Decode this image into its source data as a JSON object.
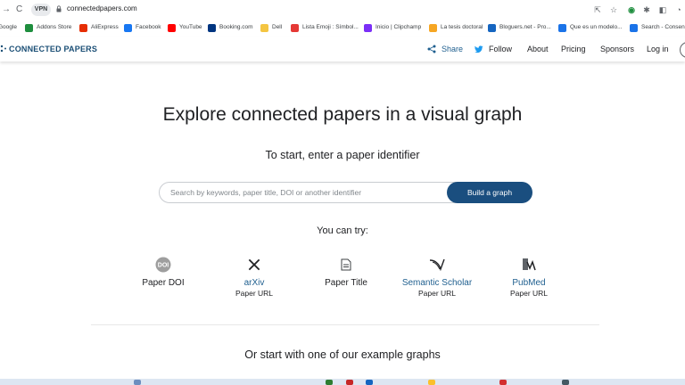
{
  "browser": {
    "url": "connectedpapers.com",
    "vpn_badge": "VPN",
    "bookmarks": [
      {
        "label": "Google",
        "color": "#ffffff"
      },
      {
        "label": "Addons Store",
        "color": "#1e8e3e"
      },
      {
        "label": "AliExpress",
        "color": "#e62e04"
      },
      {
        "label": "Facebook",
        "color": "#1877f2"
      },
      {
        "label": "YouTube",
        "color": "#ff0000"
      },
      {
        "label": "Booking.com",
        "color": "#003580"
      },
      {
        "label": "Dell",
        "color": "#f4c542"
      },
      {
        "label": "Lista Emoji : Símbol...",
        "color": "#e53935"
      },
      {
        "label": "Inicio | Clipchamp",
        "color": "#7b2ff7"
      },
      {
        "label": "La tesis doctoral",
        "color": "#f6a623"
      },
      {
        "label": "Bloguers.net - Pro...",
        "color": "#1565c0"
      },
      {
        "label": "Que es un modelo...",
        "color": "#1a73e8"
      },
      {
        "label": "Search - Consens",
        "color": "#1a73e8"
      }
    ]
  },
  "header": {
    "logo": "CONNECTED PAPERS",
    "nav": {
      "share": "Share",
      "follow": "Follow",
      "about": "About",
      "pricing": "Pricing",
      "sponsors": "Sponsors",
      "login": "Log in"
    }
  },
  "hero": {
    "title": "Explore connected papers in a visual graph",
    "subtitle": "To start, enter a paper identifier",
    "search_placeholder": "Search by keywords, paper title, DOI or another identifier",
    "build_button": "Build a graph",
    "try_label": "You can try:"
  },
  "options": [
    {
      "icon": "doi-icon",
      "name": "Paper DOI",
      "sub": ""
    },
    {
      "icon": "arxiv-icon",
      "name": "arXiv",
      "sub": "Paper URL"
    },
    {
      "icon": "document-icon",
      "name": "Paper Title",
      "sub": ""
    },
    {
      "icon": "semantic-scholar-icon",
      "name": "Semantic Scholar",
      "sub": "Paper URL"
    },
    {
      "icon": "pubmed-icon",
      "name": "PubMed",
      "sub": "Paper URL"
    }
  ],
  "examples_heading": "Or start with one of our example graphs",
  "colors": {
    "brand": "#1a4e7f",
    "link": "#1f5f8f",
    "twitter": "#1d9bf0"
  }
}
